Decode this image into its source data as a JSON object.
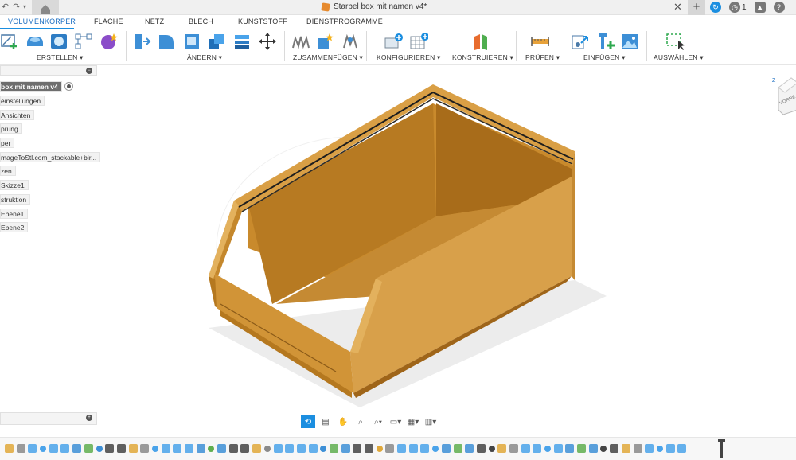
{
  "window": {
    "title": "Starbel box mit namen v4*",
    "notifications_count": "1"
  },
  "tabs": [
    "VOLUMENKÖRPER",
    "FLÄCHE",
    "NETZ",
    "BLECH",
    "KUNSTSTOFF",
    "DIENSTPROGRAMME"
  ],
  "toolbar_groups": [
    "ERSTELLEN ▾",
    "ÄNDERN ▾",
    "ZUSAMMENFÜGEN ▾",
    "KONFIGURIEREN ▾",
    "KONSTRUIEREN ▾",
    "PRÜFEN ▾",
    "EINFÜGEN ▾",
    "AUSWÄHLEN ▾"
  ],
  "browser": {
    "items": [
      "box mit namen v4",
      "einstellungen",
      "Ansichten",
      "prung",
      "per",
      "mageToStl.com_stackable+bir...",
      "zen",
      "Skizze1",
      "struktion",
      "Ebene1",
      "Ebene2"
    ]
  },
  "viewcube": {
    "axis_z": "Z",
    "face_label": "VORNE"
  },
  "colors": {
    "accent": "#1b8ee0",
    "model": "#d89a3a",
    "model_dark": "#b87a24"
  },
  "icons": {
    "titlebar": [
      "home-icon",
      "undo-icon",
      "redo-icon",
      "close-icon",
      "new-tab-icon",
      "job-status-icon",
      "notifications-icon",
      "help-icon"
    ],
    "navbar": [
      "orbit-icon",
      "look-at-icon",
      "pan-icon",
      "zoom-icon",
      "fit-icon",
      "display-settings-icon",
      "grid-settings-icon",
      "viewport-settings-icon"
    ]
  }
}
